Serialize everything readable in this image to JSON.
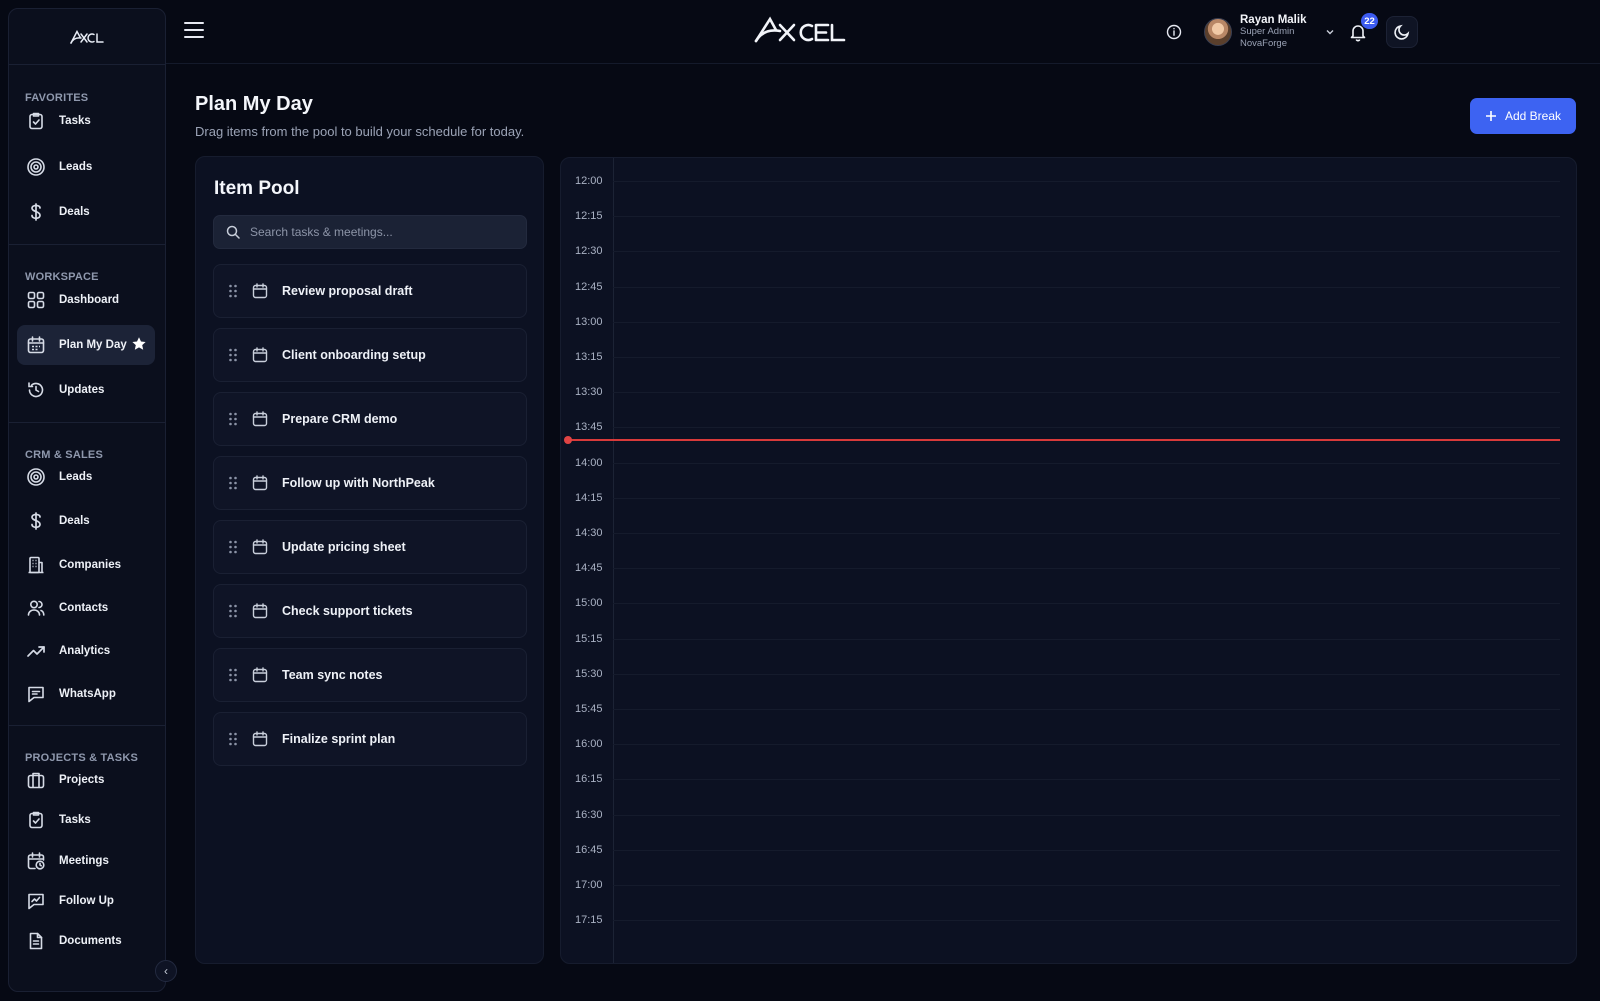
{
  "sidebar": {
    "sections": [
      {
        "title": "FAVORITES",
        "items": [
          {
            "label": "Tasks",
            "icon": "clipboard-check-icon"
          },
          {
            "label": "Leads",
            "icon": "target-icon"
          },
          {
            "label": "Deals",
            "icon": "dollar-icon"
          }
        ]
      },
      {
        "title": "WORKSPACE",
        "items": [
          {
            "label": "Dashboard",
            "icon": "grid-icon"
          },
          {
            "label": "Plan My Day",
            "icon": "calendar-icon",
            "active": true,
            "starred": true
          },
          {
            "label": "Updates",
            "icon": "history-icon"
          }
        ]
      },
      {
        "title": "CRM & SALES",
        "items": [
          {
            "label": "Leads",
            "icon": "target-icon"
          },
          {
            "label": "Deals",
            "icon": "dollar-icon"
          },
          {
            "label": "Companies",
            "icon": "building-icon"
          },
          {
            "label": "Contacts",
            "icon": "users-icon"
          },
          {
            "label": "Analytics",
            "icon": "trend-up-icon"
          },
          {
            "label": "WhatsApp",
            "icon": "message-icon"
          }
        ]
      },
      {
        "title": "PROJECTS & TASKS",
        "items": [
          {
            "label": "Projects",
            "icon": "briefcase-icon"
          },
          {
            "label": "Tasks",
            "icon": "clipboard-check-icon"
          },
          {
            "label": "Meetings",
            "icon": "calendar-clock-icon"
          },
          {
            "label": "Follow Up",
            "icon": "chat-trend-icon"
          },
          {
            "label": "Documents",
            "icon": "document-icon"
          }
        ]
      }
    ]
  },
  "header": {
    "brand": "XCEL",
    "user": {
      "name": "Rayan Malik",
      "role": "Super Admin",
      "org": "NovaForge"
    },
    "notifications_count": "22"
  },
  "page": {
    "title": "Plan My Day",
    "subtitle": "Drag items from the pool to build your schedule for today.",
    "add_break_label": "Add Break"
  },
  "pool": {
    "title": "Item Pool",
    "search_placeholder": "Search tasks & meetings...",
    "items": [
      "Review proposal draft",
      "Client onboarding setup",
      "Prepare CRM demo",
      "Follow up with NorthPeak",
      "Update pricing sheet",
      "Check support tickets",
      "Team sync notes",
      "Finalize sprint plan"
    ]
  },
  "timeline": {
    "times": [
      "12:00",
      "12:15",
      "12:30",
      "12:45",
      "13:00",
      "13:15",
      "13:30",
      "13:45",
      "14:00",
      "14:15",
      "14:30",
      "14:45",
      "15:00",
      "15:15",
      "15:30",
      "15:45",
      "16:00",
      "16:15",
      "16:30",
      "16:45",
      "17:00",
      "17:15"
    ],
    "now_indicator_color": "#d93a3a"
  },
  "colors": {
    "accent": "#3d63f2",
    "background": "#060914",
    "panel": "#0c1122"
  }
}
